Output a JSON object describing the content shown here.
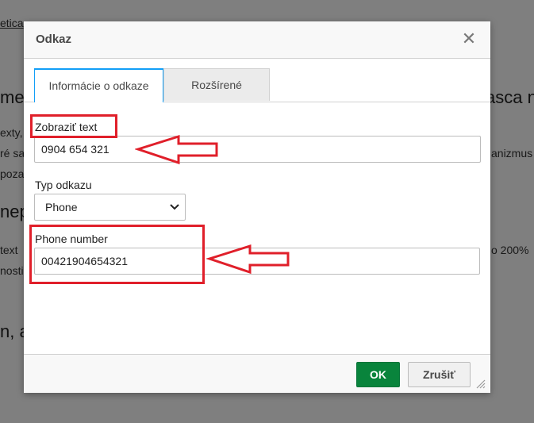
{
  "background": {
    "top_line": "etica",
    "heading1_left": "med",
    "heading1_right": "asca n",
    "para1_left": "exty,",
    "para2_left": "ré sa",
    "para2_right": "anizmus",
    "para3_left": "poza",
    "heading2_left": "nep",
    "para4_left": "text",
    "para4_right": "o 200%",
    "para5_left": "nosti",
    "heading3_left": "n, a"
  },
  "dialog": {
    "title": "Odkaz",
    "close_glyph": "✕",
    "tabs": [
      "Informácie o odkaze",
      "Rozšírené"
    ],
    "display_text_label": "Zobraziť text",
    "display_text_value": "0904 654 321",
    "link_type_label": "Typ odkazu",
    "link_type_value": "Phone",
    "phone_label": "Phone number",
    "phone_value": "00421904654321",
    "ok_label": "OK",
    "cancel_label": "Zrušiť"
  },
  "colors": {
    "annotation": "#e01f2a",
    "ok_button": "#09843c",
    "active_tab_border": "#139ff7"
  }
}
